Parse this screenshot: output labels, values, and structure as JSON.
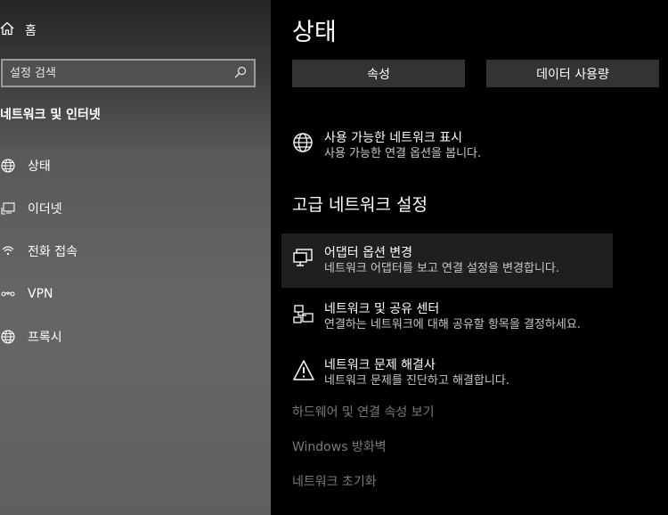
{
  "sidebar": {
    "home_label": "홈",
    "search_placeholder": "설정 검색",
    "section_title": "네트워크 및 인터넷",
    "items": [
      {
        "label": "상태",
        "icon": "globe-icon"
      },
      {
        "label": "이더넷",
        "icon": "ethernet-icon"
      },
      {
        "label": "전화 접속",
        "icon": "dialup-icon"
      },
      {
        "label": "VPN",
        "icon": "vpn-icon"
      },
      {
        "label": "프록시",
        "icon": "globe-icon"
      }
    ]
  },
  "main": {
    "title": "상태",
    "buttons": {
      "properties": "속성",
      "data_usage": "데이터 사용량"
    },
    "show_networks": {
      "title": "사용 가능한 네트워크 표시",
      "desc": "사용 가능한 연결 옵션을 봅니다."
    },
    "advanced_heading": "고급 네트워크 설정",
    "adapter": {
      "title": "어댑터 옵션 변경",
      "desc": "네트워크 어댑터를 보고 연결 설정을 변경합니다."
    },
    "sharing": {
      "title": "네트워크 및 공유 센터",
      "desc": "연결하는 네트워크에 대해 공유할 항목을 결정하세요."
    },
    "troubleshoot": {
      "title": "네트워크 문제 해결사",
      "desc": "네트워크 문제를 진단하고 해결합니다."
    },
    "links": {
      "hardware": "하드웨어 및 연결 속성 보기",
      "firewall": "Windows 방화벽",
      "reset": "네트워크 초기화"
    }
  }
}
